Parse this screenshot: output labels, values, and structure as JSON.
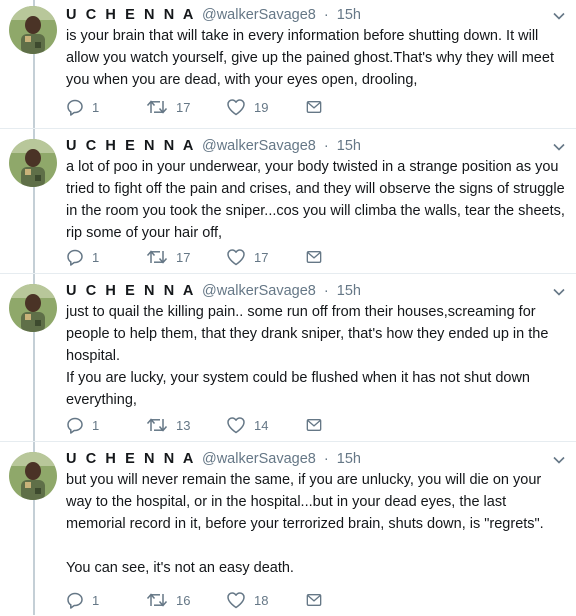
{
  "thread": [
    {
      "author_name": "U C H E N N A",
      "handle": "@walkerSavage8",
      "separator": "·",
      "time": "15h",
      "text": "is your brain that will take in every information before shutting down. It will allow you watch yourself, give up the pained ghost.That's why they will meet you when you are dead, with your eyes open, drooling,",
      "replies": "1",
      "retweets": "17",
      "likes": "19"
    },
    {
      "author_name": "U C H E N N A",
      "handle": "@walkerSavage8",
      "separator": "·",
      "time": "15h",
      "text": "a lot of poo in your underwear, your body twisted in a strange position as you tried to fight off the pain and crises, and they will observe the signs of struggle in the room you took the sniper...cos you will climba the walls, tear the sheets, rip some of your hair off,",
      "replies": "1",
      "retweets": "17",
      "likes": "17"
    },
    {
      "author_name": "U C H E N N A",
      "handle": "@walkerSavage8",
      "separator": "·",
      "time": "15h",
      "text": "just to quail the killing pain.. some run off from their houses,screaming for people to help them, that they drank sniper, that's how they ended up in the hospital.\nIf you are lucky, your system could be flushed when it has not shut down everything,",
      "replies": "1",
      "retweets": "13",
      "likes": "14"
    },
    {
      "author_name": "U C H E N N A",
      "handle": "@walkerSavage8",
      "separator": "·",
      "time": "15h",
      "text": "but you will never remain the same, if you are unlucky, you will die on your way to the hospital, or in the hospital...but in your dead eyes, the last memorial record in it, before your terrorized brain, shuts down, is \"regrets\".\n\nYou can see, it's not an easy death.",
      "replies": "1",
      "retweets": "16",
      "likes": "18"
    }
  ],
  "colors": {
    "text": "#14171a",
    "secondary": "#657786",
    "thread_line": "#c4cfd6",
    "divider": "#e6ecf0"
  },
  "icons": [
    "avatar",
    "chevron-down-icon",
    "reply-icon",
    "retweet-icon",
    "like-icon",
    "direct-message-icon"
  ]
}
